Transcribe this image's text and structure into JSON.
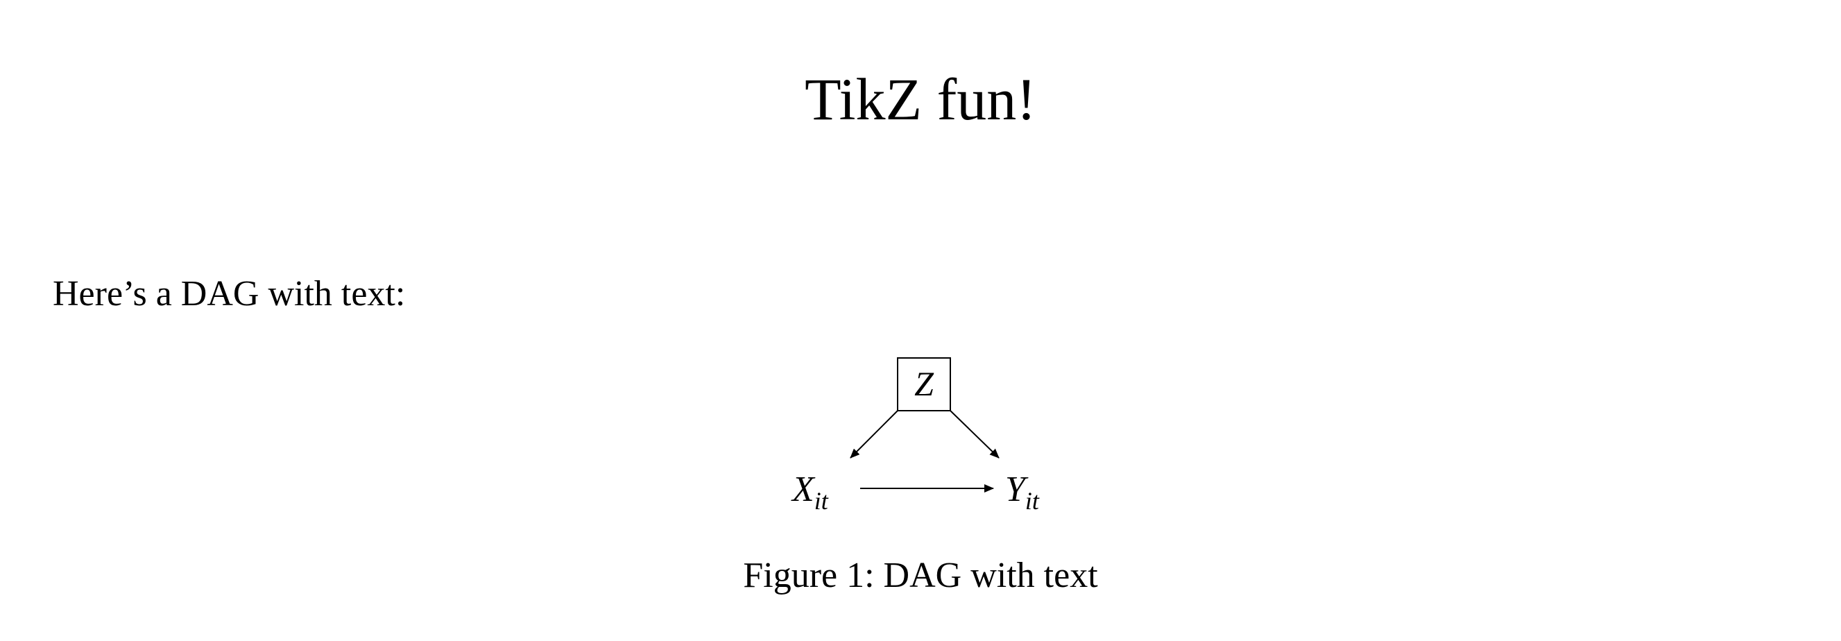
{
  "document": {
    "title": "TikZ fun!",
    "intro_text": "Here’s a DAG with text:",
    "figure": {
      "caption": "Figure 1: DAG with text",
      "nodes": [
        {
          "id": "z",
          "label": "Z",
          "subscript": "",
          "boxed": true
        },
        {
          "id": "x",
          "label": "X",
          "subscript": "it",
          "boxed": false
        },
        {
          "id": "y",
          "label": "Y",
          "subscript": "it",
          "boxed": false
        }
      ],
      "edges": [
        {
          "from": "z",
          "to": "x"
        },
        {
          "from": "z",
          "to": "y"
        },
        {
          "from": "x",
          "to": "y"
        }
      ]
    }
  }
}
